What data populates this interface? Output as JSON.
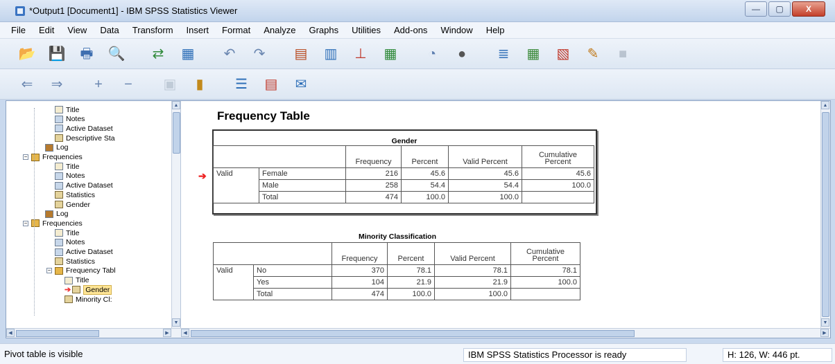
{
  "window": {
    "title": "*Output1 [Document1] - IBM SPSS Statistics Viewer",
    "minimize": "—",
    "maximize": "▢",
    "close": "X"
  },
  "menu": [
    "File",
    "Edit",
    "View",
    "Data",
    "Transform",
    "Insert",
    "Format",
    "Analyze",
    "Graphs",
    "Utilities",
    "Add-ons",
    "Window",
    "Help"
  ],
  "toolbar1": [
    {
      "icon": "open-icon",
      "glyph": "📂"
    },
    {
      "icon": "save-icon",
      "glyph": "💾"
    },
    {
      "icon": "print-icon",
      "glyph": "🖶"
    },
    {
      "icon": "print-preview-icon",
      "glyph": "🔍"
    },
    {
      "icon": "export-icon",
      "glyph": "⇄"
    },
    {
      "icon": "recall-dialog-icon",
      "glyph": "▦"
    },
    {
      "icon": "undo-icon",
      "glyph": "↶"
    },
    {
      "icon": "redo-icon",
      "glyph": "↷"
    },
    {
      "icon": "goto-data-icon",
      "glyph": "▤"
    },
    {
      "icon": "goto-case-icon",
      "glyph": "▥"
    },
    {
      "icon": "goto-variable-icon",
      "glyph": "⊥"
    },
    {
      "icon": "variables-icon",
      "glyph": "▦"
    },
    {
      "icon": "designate-window-icon",
      "glyph": "◔"
    },
    {
      "icon": "select-cases-icon",
      "glyph": "●"
    },
    {
      "icon": "value-labels-icon",
      "glyph": "≣"
    },
    {
      "icon": "use-sets-icon",
      "glyph": "▦"
    },
    {
      "icon": "show-all-icon",
      "glyph": "▧"
    },
    {
      "icon": "spelling-icon",
      "glyph": "✎"
    },
    {
      "icon": "run-script-icon",
      "glyph": "■"
    }
  ],
  "toolbar2": [
    {
      "icon": "back-icon",
      "glyph": "⇐"
    },
    {
      "icon": "forward-icon",
      "glyph": "⇒"
    },
    {
      "icon": "promote-icon",
      "glyph": "+"
    },
    {
      "icon": "demote-icon",
      "glyph": "−"
    },
    {
      "icon": "show-icon",
      "glyph": "▣"
    },
    {
      "icon": "hide-icon",
      "glyph": "▮"
    },
    {
      "icon": "insert-heading-icon",
      "glyph": "☰"
    },
    {
      "icon": "insert-title-icon",
      "glyph": "▤"
    },
    {
      "icon": "insert-text-icon",
      "glyph": "✉"
    }
  ],
  "outline": [
    {
      "label": "Title",
      "icon": "title-icon",
      "cls": "ti"
    },
    {
      "label": "Notes",
      "icon": "notes-icon",
      "cls": "ti note"
    },
    {
      "label": "Active Dataset",
      "icon": "active-dataset-icon",
      "cls": "ti note"
    },
    {
      "label": "Descriptive Sta",
      "icon": "pivot-table-icon",
      "cls": "ti tbl"
    },
    {
      "label": "Log",
      "icon": "log-icon",
      "cls": "ti book"
    },
    {
      "label": "Frequencies",
      "icon": "folder-icon",
      "cls": "ti fold",
      "pm": "−"
    },
    {
      "label": "Title",
      "icon": "title-icon",
      "cls": "ti"
    },
    {
      "label": "Notes",
      "icon": "notes-icon",
      "cls": "ti note"
    },
    {
      "label": "Active Dataset",
      "icon": "active-dataset-icon",
      "cls": "ti note"
    },
    {
      "label": "Statistics",
      "icon": "pivot-table-icon",
      "cls": "ti tbl"
    },
    {
      "label": "Gender",
      "icon": "pivot-table-icon",
      "cls": "ti tbl"
    },
    {
      "label": "Log",
      "icon": "log-icon",
      "cls": "ti book"
    },
    {
      "label": "Frequencies",
      "icon": "folder-icon",
      "cls": "ti fold",
      "pm": "−"
    },
    {
      "label": "Title",
      "icon": "title-icon",
      "cls": "ti"
    },
    {
      "label": "Notes",
      "icon": "notes-icon",
      "cls": "ti note"
    },
    {
      "label": "Active Dataset",
      "icon": "active-dataset-icon",
      "cls": "ti note"
    },
    {
      "label": "Statistics",
      "icon": "pivot-table-icon",
      "cls": "ti tbl"
    },
    {
      "label": "Frequency Tabl",
      "icon": "folder-icon",
      "cls": "ti fold",
      "pm": "−"
    },
    {
      "label": "Title",
      "icon": "title-icon",
      "cls": "ti"
    },
    {
      "label": "Gender",
      "icon": "pivot-table-icon",
      "cls": "ti tbl",
      "sel": true
    },
    {
      "label": "Minority Cl:",
      "icon": "pivot-table-icon",
      "cls": "ti tbl"
    }
  ],
  "output": {
    "heading": "Frequency Table",
    "gender": {
      "title": "Gender",
      "headers": [
        "Frequency",
        "Percent",
        "Valid Percent",
        "Cumulative Percent"
      ],
      "group": "Valid",
      "rows": [
        [
          "Female",
          "216",
          "45.6",
          "45.6",
          "45.6"
        ],
        [
          "Male",
          "258",
          "54.4",
          "54.4",
          "100.0"
        ],
        [
          "Total",
          "474",
          "100.0",
          "100.0",
          ""
        ]
      ]
    },
    "minority": {
      "title": "Minority Classification",
      "headers": [
        "Frequency",
        "Percent",
        "Valid Percent",
        "Cumulative Percent"
      ],
      "group": "Valid",
      "rows": [
        [
          "No",
          "370",
          "78.1",
          "78.1",
          "78.1"
        ],
        [
          "Yes",
          "104",
          "21.9",
          "21.9",
          "100.0"
        ],
        [
          "Total",
          "474",
          "100.0",
          "100.0",
          ""
        ]
      ]
    }
  },
  "status": {
    "left": "Pivot table is visible",
    "processor": "IBM SPSS Statistics Processor is ready",
    "dims": "H: 126, W: 446 pt."
  }
}
